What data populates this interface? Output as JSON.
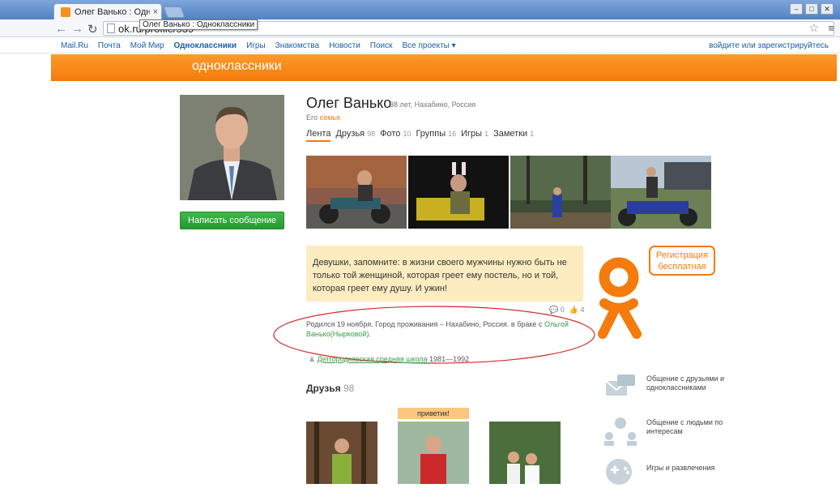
{
  "browser": {
    "tab_title": "Олег Ванько : Одноклассники",
    "tab_close": "×",
    "tooltip": "Олег Ванько : Одноклассники",
    "url": "ok.ru/profile/539"
  },
  "portal": {
    "links": [
      "Mail.Ru",
      "Почта",
      "Мой Мир",
      "Одноклассники",
      "Игры",
      "Знакомства",
      "Новости",
      "Поиск",
      "Все проекты ▾"
    ],
    "login": "войдите или зарегистрируйтесь"
  },
  "header": {
    "logo": "одноклассники"
  },
  "profile": {
    "name": "Олег Ванько",
    "meta": "38 лет, Нахабино, Россия",
    "family_prefix": "Его",
    "family_link": "семья",
    "message_button": "Написать сообщение"
  },
  "tabs": [
    {
      "label": "Лента",
      "count": ""
    },
    {
      "label": "Друзья",
      "count": "98"
    },
    {
      "label": "Фото",
      "count": "10"
    },
    {
      "label": "Группы",
      "count": "16"
    },
    {
      "label": "Игры",
      "count": "1"
    },
    {
      "label": "Заметки",
      "count": "1"
    }
  ],
  "status": {
    "text": "Девушки, запомните: в жизни своего мужчины нужно быть не только той женщиной, которая греет ему постель, но и той, которая греет ему душу. И ужин!",
    "comments": "0",
    "likes": "4"
  },
  "about": {
    "text": "Родился 19 ноября. Город проживания – Нахабино, Россия. в браке с",
    "spouse_link": "Ольгой Ванько(Нырковой)",
    "end": "."
  },
  "school": {
    "name": "Детгородковская средняя школа",
    "years": "1981—1992"
  },
  "friends": {
    "title": "Друзья",
    "count": "98",
    "badge": "приветик!"
  },
  "promo": {
    "bubble": "Регистрация бесплатная",
    "features": [
      "Общение с друзьями и одноклассниками",
      "Общение с людьми по интересам",
      "Игры и развлечения"
    ]
  },
  "colors": {
    "accent": "#f47b0c",
    "green": "#26992f",
    "quote_bg": "#fdecc0",
    "link": "#1a5da8"
  }
}
